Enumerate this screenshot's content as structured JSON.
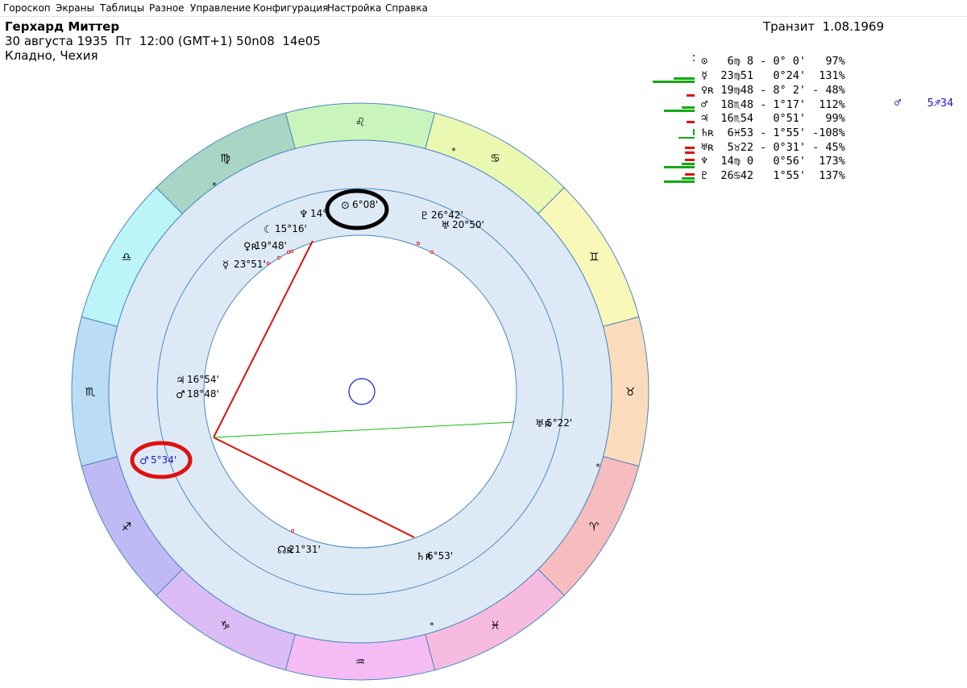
{
  "menu": [
    "Гороскоп",
    "Экраны",
    "Таблицы",
    "Разное",
    "Управление",
    "Конфигурация",
    "Настройка",
    "Справка"
  ],
  "header": {
    "name": "Герхард Миттер",
    "details": "30 августа 1935  Пт  12:00 (GMT+1) 50n08  14e05",
    "place": "Кладно, Чехия",
    "transit": "Транзит  1.08.1969"
  },
  "colors": {
    "red": "#e01010",
    "green": "#13a813",
    "blue": "#1a1acc",
    "black_circle": "#000000",
    "ring": "#ddeaf6"
  },
  "table": [
    {
      "text": "⊙   6♍ 8 - 0° 0'   97%",
      "bars": [
        [
          "#e01010",
          2,
          0,
          2
        ],
        [
          "#13a813",
          2,
          6,
          2
        ]
      ]
    },
    {
      "text": "☿  23♍51   0°24'  131%",
      "bars": [
        [
          "#13a813",
          26,
          10,
          3
        ],
        [
          "#13a813",
          52,
          14,
          3
        ]
      ]
    },
    {
      "text": "♀ʀ 19♍48 - 8° 2' - 48%",
      "bars": [
        [
          "#e01010",
          10,
          13,
          3
        ]
      ]
    },
    {
      "text": "♂  18♏48 - 1°17'  112%",
      "bars": [
        [
          "#13a813",
          16,
          10,
          3
        ],
        [
          "#13a813",
          38,
          14,
          3
        ]
      ]
    },
    {
      "text": "♃  16♏54   0°51'   99%",
      "bars": [
        [
          "#e01010",
          10,
          11,
          3
        ]
      ]
    },
    {
      "text": "♄ʀ  6♓53 - 1°55' -108%",
      "bars": [
        [
          "#13a813",
          2,
          3,
          8
        ],
        [
          "#13a813",
          20,
          13,
          2
        ]
      ]
    },
    {
      "text": "♅ʀ  5♉22 - 0°31' - 45%",
      "bars": [
        [
          "#e01010",
          12,
          7,
          3
        ],
        [
          "#e01010",
          12,
          13,
          3
        ]
      ]
    },
    {
      "text": "♆  14♍ 0   0°56'  173%",
      "bars": [
        [
          "#e01010",
          12,
          5,
          3
        ],
        [
          "#13a813",
          16,
          10,
          3
        ],
        [
          "#13a813",
          38,
          14,
          3
        ]
      ]
    },
    {
      "text": "♇  26♋42   1°55'  137%",
      "bars": [
        [
          "#e01010",
          12,
          5,
          3
        ],
        [
          "#13a813",
          16,
          10,
          3
        ],
        [
          "#13a813",
          38,
          14,
          3
        ]
      ]
    }
  ],
  "table_extra": "♂    5♐34",
  "zodiac_signs": [
    "♌",
    "♋",
    "♊",
    "♉",
    "♈",
    "♓",
    "♒",
    "♑",
    "♐",
    "♏",
    "♎",
    "♍"
  ],
  "chart_planets": [
    {
      "glyph": "♆",
      "label": "14°"
    },
    {
      "glyph": "⊙",
      "label": "6°08'"
    },
    {
      "glyph": "♇",
      "label": "26°42'"
    },
    {
      "glyph": "♅",
      "label": "20°50'"
    },
    {
      "glyph": "☾",
      "label": "15°16'"
    },
    {
      "glyph": "♀ʀ",
      "label": "19°48'"
    },
    {
      "glyph": "☿",
      "label": "23°51'"
    },
    {
      "glyph": "♃",
      "label": "16°54'"
    },
    {
      "glyph": "♂",
      "label": "18°48'"
    },
    {
      "glyph": "♅ʀ",
      "label": "5°22'"
    },
    {
      "glyph": "☊ʀ",
      "label": "21°31'"
    },
    {
      "glyph": "♄ʀ",
      "label": "6°53'"
    },
    {
      "glyph": "♂",
      "label": "5°34'"
    }
  ]
}
